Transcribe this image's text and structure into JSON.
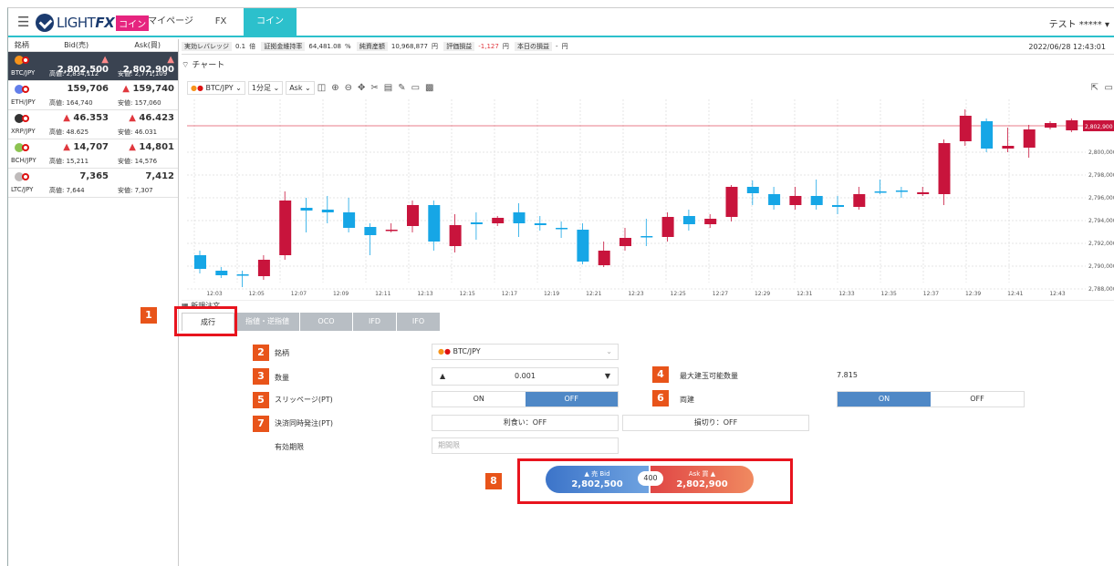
{
  "nav": {
    "logo": "LIGHT",
    "logo_fx": "FX",
    "logo_coin": "コイン",
    "tabs": [
      "マイページ",
      "FX",
      "コイン"
    ],
    "user": "テスト *****"
  },
  "rates": {
    "headers": [
      "銘柄",
      "Bid(売)",
      "Ask(買)"
    ],
    "rows": [
      {
        "pair": "BTC/JPY",
        "bid": "2,802,500",
        "ask": "2,802,900",
        "high": "高値: 2,834,112",
        "low": "安値: 2,771,109",
        "bid_arrow": "▲",
        "ask_arrow": "▲",
        "color": "#f7931a"
      },
      {
        "pair": "ETH/JPY",
        "bid": "159,706",
        "ask": "159,740",
        "high": "高値: 164,740",
        "low": "安値: 157,060",
        "bid_arrow": "",
        "ask_arrow": "▲",
        "color": "#627eea"
      },
      {
        "pair": "XRP/JPY",
        "bid": "46.353",
        "ask": "46.423",
        "high": "高値: 48.625",
        "low": "安値: 46.031",
        "bid_arrow": "▲",
        "ask_arrow": "▲",
        "color": "#333333"
      },
      {
        "pair": "BCH/JPY",
        "bid": "14,707",
        "ask": "14,801",
        "high": "高値: 15,211",
        "low": "安値: 14,576",
        "bid_arrow": "▲",
        "ask_arrow": "▲",
        "color": "#8dc351"
      },
      {
        "pair": "LTC/JPY",
        "bid": "7,365",
        "ask": "7,412",
        "high": "高値: 7,644",
        "low": "安値: 7,307",
        "bid_arrow": "",
        "ask_arrow": "",
        "color": "#bfbbbb"
      }
    ]
  },
  "stats": {
    "leverage_label": "実効レバレッジ",
    "leverage": "0.1",
    "leverage_unit": "倍",
    "margin_ratio_label": "証拠金維持率",
    "margin_ratio": "64,481.08",
    "margin_ratio_unit": "%",
    "net_assets_label": "純資産額",
    "net_assets": "10,968,877",
    "yen": "円",
    "pl_label": "評価損益",
    "pl": "-1,127",
    "today_label": "本日の損益",
    "today": "-",
    "datetime": "2022/06/28 12:43:01"
  },
  "chart_title": "チャート",
  "toolbar": {
    "symbol": "BTC/JPY",
    "interval": "1分足",
    "side": "Ask"
  },
  "chart_data": {
    "type": "candlestick",
    "x": [
      "12:03",
      "12:05",
      "12:07",
      "12:09",
      "12:11",
      "12:13",
      "12:15",
      "12:17",
      "12:19",
      "12:21",
      "12:23",
      "12:25",
      "12:27",
      "12:29",
      "12:31",
      "12:33",
      "12:35",
      "12:37",
      "12:39",
      "12:41",
      "12:43"
    ],
    "ylabels": [
      "2,800,000",
      "2,798,000",
      "2,796,000",
      "2,794,000",
      "2,792,000",
      "2,790,000",
      "2,788,000"
    ],
    "current_price": "2,802,900"
  },
  "order_section": "新規注文",
  "order_tabs": [
    "成行",
    "指値・逆指値",
    "OCO",
    "IFD",
    "IFO"
  ],
  "form": {
    "symbol_label": "銘柄",
    "symbol": "BTC/JPY",
    "qty_label": "数量",
    "qty": "0.001",
    "max_label": "最大建玉可能数量",
    "max": "7.815",
    "slip_label": "スリッページ(PT)",
    "on": "ON",
    "off": "OFF",
    "both_label": "両建",
    "settle_label": "決済同時発注(PT)",
    "take_profit": "利食い：OFF",
    "stop_loss": "損切り：OFF",
    "expiry_label": "有効期限",
    "expiry_placeholder": "期間限"
  },
  "buttons": {
    "sell_label": "▲ 売 Bid",
    "sell_price": "2,802,500",
    "spread": "400",
    "buy_label": "Ask 買 ▲",
    "buy_price": "2,802,900"
  },
  "annotations": [
    "1",
    "2",
    "3",
    "4",
    "5",
    "6",
    "7",
    "8"
  ]
}
